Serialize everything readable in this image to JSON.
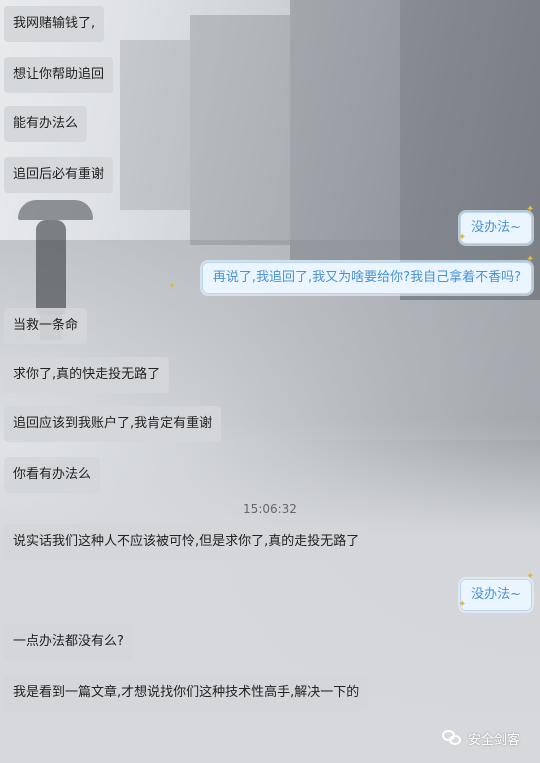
{
  "messages_left_top": [
    "我网赌输钱了,",
    "想让你帮助追回",
    "能有办法么",
    "追回后必有重谢"
  ],
  "reply_1": "没办法~",
  "reply_2": "再说了,我追回了,我又为啥要给你?我自己拿着不香吗?",
  "messages_left_mid": [
    "当救一条命",
    "求你了,真的快走投无路了",
    "追回应该到我账户了,我肯定有重谢",
    "你看有办法么"
  ],
  "timestamp": "15:06:32",
  "message_after_time": "说实话我们这种人不应该被可怜,但是求你了,真的走投无路了",
  "reply_3": "没办法~",
  "messages_left_bottom": [
    "一点办法都没有么?",
    "我是看到一篇文章,才想说找你们这种技术性高手,解决一下的"
  ],
  "watermark": "安全剑客",
  "colors": {
    "reply_text": "#4a92d2",
    "reply_bg": "#eaf5ff",
    "left_bubble_bg": "#d4d6d9"
  }
}
